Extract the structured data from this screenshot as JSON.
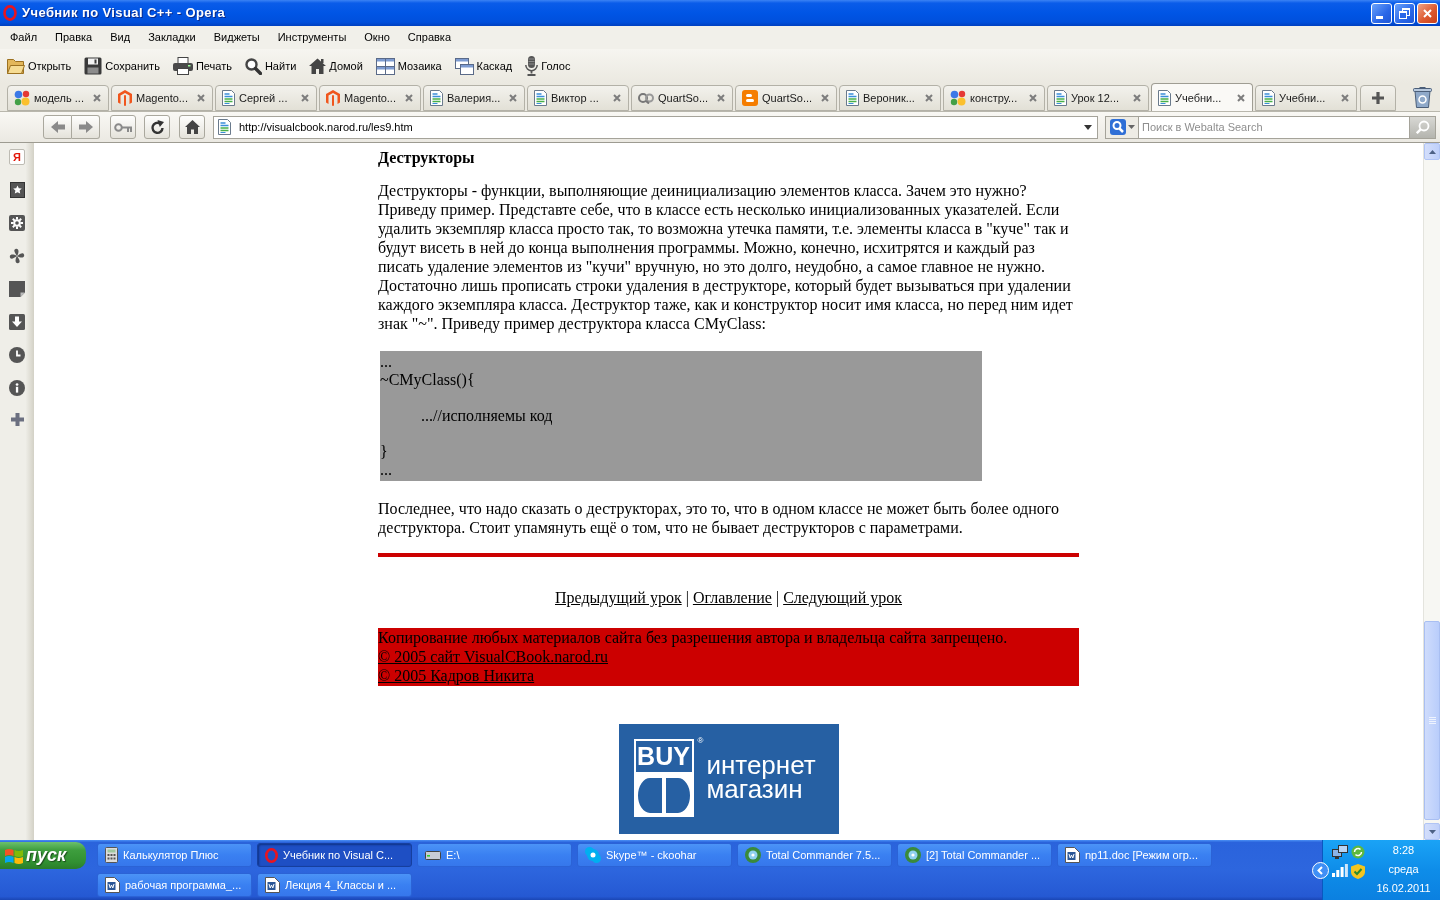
{
  "window": {
    "title": "Учебник по Visual C++ - Opera"
  },
  "menu": [
    "Файл",
    "Правка",
    "Вид",
    "Закладки",
    "Виджеты",
    "Инструменты",
    "Окно",
    "Справка"
  ],
  "toolbar": [
    {
      "kind": "open",
      "label": "Открыть"
    },
    {
      "kind": "save",
      "label": "Сохранить"
    },
    {
      "kind": "print",
      "label": "Печать"
    },
    {
      "kind": "find",
      "label": "Найти"
    },
    {
      "kind": "home",
      "label": "Домой"
    },
    {
      "kind": "tile",
      "label": "Мозаика"
    },
    {
      "kind": "cascade",
      "label": "Каскад"
    },
    {
      "kind": "voice",
      "label": "Голос"
    }
  ],
  "tabs": [
    {
      "kind": "google",
      "label": "модель ...",
      "selected": false
    },
    {
      "kind": "magento",
      "label": "Magento...",
      "selected": false
    },
    {
      "kind": "page",
      "label": "Сергей ...",
      "selected": false
    },
    {
      "kind": "magento",
      "label": "Magento...",
      "selected": false
    },
    {
      "kind": "page",
      "label": "Валерия...",
      "selected": false
    },
    {
      "kind": "page",
      "label": "Виктор ...",
      "selected": false
    },
    {
      "kind": "qs",
      "label": "QuartSo...",
      "selected": false
    },
    {
      "kind": "blogger",
      "label": "QuartSo...",
      "selected": false
    },
    {
      "kind": "page",
      "label": "Вероник...",
      "selected": false
    },
    {
      "kind": "google",
      "label": "констру...",
      "selected": false
    },
    {
      "kind": "page",
      "label": "Урок 12...",
      "selected": false
    },
    {
      "kind": "page",
      "label": "Учебни...",
      "selected": true
    },
    {
      "kind": "page",
      "label": "Учебни...",
      "selected": false
    }
  ],
  "address_bar": {
    "url": "http://visualcbook.narod.ru/les9.htm"
  },
  "search": {
    "placeholder": "Поиск в Webalta Search"
  },
  "side_panel": {
    "logo_letter": "Я"
  },
  "page": {
    "heading": "Деструкторы",
    "intro": "Деструкторы - функции, выполняющие деинициализацию элементов класса. Зачем это нужно? Приведу пример. Представте себе, что в классе есть несколько инициализованных указателей. Если удалить экземпляр класса просто так, то возможна утечка памяти, т.е. элементы класса в \"куче\" так и будут висеть в ней до конца выполнения программы. Можно, конечно, исхитрятся и каждый раз писать удаление элементов из \"кучи\" вручную, но это долго, неудобно, а самое главное не нужно. Достаточно лишь прописать строки удаления в деструкторе, который будет вызываться при удалении каждого экземпляра класса. Деструктор таже, как и конструктор носит имя класса, но перед ним идет знак \"~\". Приведу пример деструктора класса CMyClass:",
    "code_block": {
      "paragraphs": [
        {
          "lines": [
            "...",
            "~CMyClass(){"
          ],
          "indented": false
        },
        {
          "lines": [
            "...//исполняемы код"
          ],
          "indented": true
        },
        {
          "lines": [
            "}",
            "..."
          ],
          "indented": false
        }
      ]
    },
    "closing": "Последнее, что надо сказать о деструкторах, это то, что в одном классе не может быть более одного деструктора. Стоит упамянуть ещё о том, что не бывает деструкторов с параметрами.",
    "nav_links": [
      {
        "kind": "link",
        "text": "Предыдущий урок"
      },
      {
        "kind": "separator",
        "text": "|"
      },
      {
        "kind": "link",
        "text": "Оглавление"
      },
      {
        "kind": "separator",
        "text": "|"
      },
      {
        "kind": "link",
        "text": "Следующий урок"
      }
    ],
    "footer": {
      "lines": [
        {
          "kind": "text",
          "text": "Копирование любых материалов сайта без разрешения автора и владельца сайта запрещено."
        },
        {
          "kind": "link",
          "text": "© 2005 сайт VisualCBook.narod.ru"
        },
        {
          "kind": "link",
          "text": "© 2005 Кадров Никита"
        }
      ]
    },
    "banner": {
      "logo_text": "BUY",
      "mark": "®",
      "tagline": [
        "интернет",
        "магазин"
      ]
    }
  },
  "taskbar": {
    "start": "пуск",
    "tasks": [
      {
        "kind": "calculator",
        "label": "Калькулятор Плюс",
        "selected": false
      },
      {
        "kind": "browser",
        "label": "Учебник по Visual C...",
        "selected": true
      },
      {
        "kind": "drive",
        "label": "E:\\",
        "selected": false
      },
      {
        "kind": "chat",
        "label": "Skype™ - ckoohar",
        "selected": false
      },
      {
        "kind": "commander",
        "label": "Total Commander 7.5...",
        "selected": false
      },
      {
        "kind": "commander",
        "label": "[2] Total Commander ...",
        "selected": false
      },
      {
        "kind": "document",
        "label": "np11.doc [Режим огр...",
        "selected": false
      },
      {
        "kind": "document",
        "label": "рабочая программа_...",
        "selected": false
      },
      {
        "kind": "document",
        "label": "Лекция 4_Классы и ...",
        "selected": false
      }
    ],
    "tray": {
      "time": "8:28",
      "weekday": "среда",
      "date": "16.02.2011"
    }
  }
}
